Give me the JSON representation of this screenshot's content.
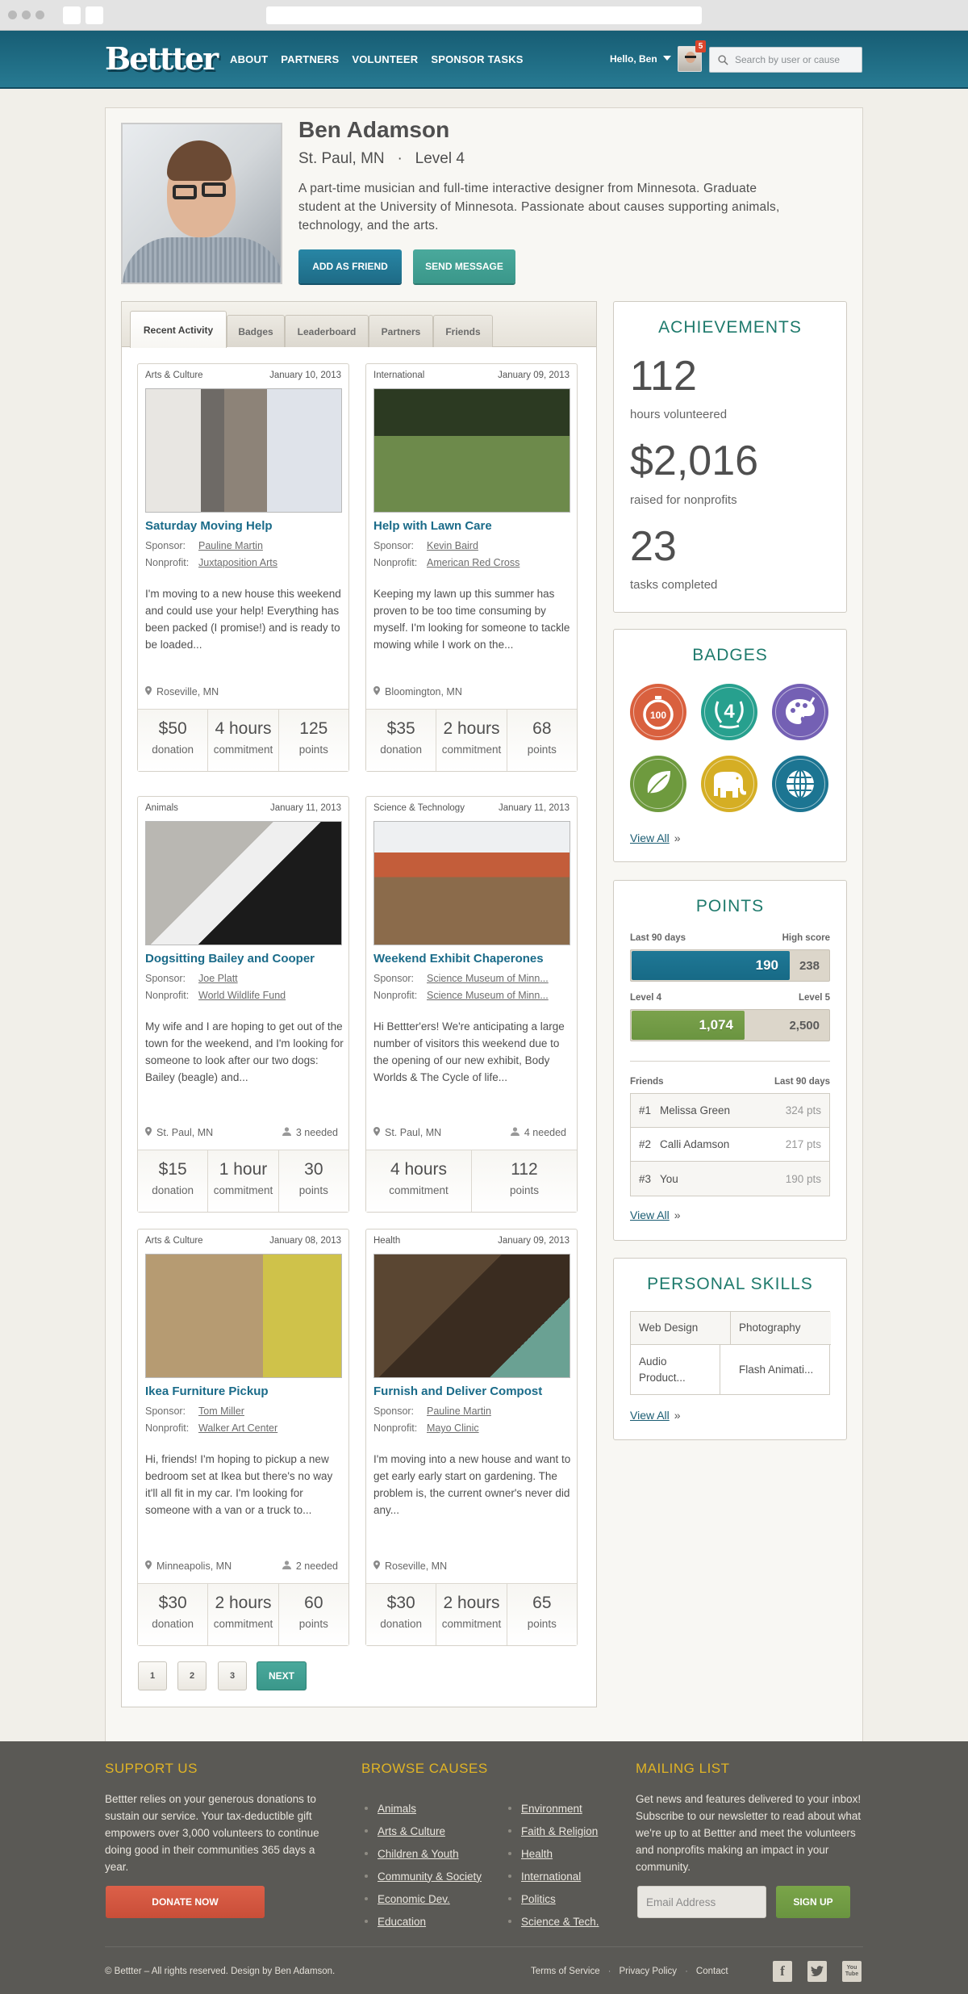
{
  "header": {
    "logo": "Bettter",
    "nav": [
      "ABOUT",
      "PARTNERS",
      "VOLUNTEER",
      "SPONSOR TASKS"
    ],
    "greeting": "Hello, Ben",
    "notification_count": "5",
    "search_placeholder": "Search by user or cause"
  },
  "profile": {
    "name": "Ben Adamson",
    "location_level": "St. Paul, MN   ·   Level 4",
    "bio": "A part-time musician and full-time interactive designer from Minnesota. Graduate student at the University of Minnesota. Passionate about causes supporting animals, technology, and the arts.",
    "add_friend_label": "ADD AS FRIEND",
    "send_message_label": "SEND MESSAGE"
  },
  "tabs": [
    "Recent Activity",
    "Badges",
    "Leaderboard",
    "Partners",
    "Friends"
  ],
  "active_tab": "Recent Activity",
  "cards": [
    {
      "category": "Arts & Culture",
      "date": "January 10, 2013",
      "title": "Saturday Moving Help",
      "sponsor_label": "Sponsor:",
      "sponsor": "Pauline Martin",
      "nonprofit_label": "Nonprofit:",
      "nonprofit": "Juxtaposition Arts",
      "description": "I'm moving to a new house this weekend and could use your help! Everything has been packed (I promise!) and is ready to be loaded...",
      "location": "Roseville, MN",
      "needed": "",
      "stats": [
        {
          "value": "$50",
          "label": "donation"
        },
        {
          "value": "4 hours",
          "label": "commitment"
        },
        {
          "value": "125",
          "label": "points"
        }
      ]
    },
    {
      "category": "International",
      "date": "January 09, 2013",
      "title": "Help with Lawn Care",
      "sponsor_label": "Sponsor:",
      "sponsor": "Kevin Baird",
      "nonprofit_label": "Nonprofit:",
      "nonprofit": "American Red Cross",
      "description": "Keeping my lawn up this summer has proven to be too time consuming by myself. I'm looking for someone to tackle mowing while I work on the...",
      "location": "Bloomington, MN",
      "needed": "",
      "stats": [
        {
          "value": "$35",
          "label": "donation"
        },
        {
          "value": "2 hours",
          "label": "commitment"
        },
        {
          "value": "68",
          "label": "points"
        }
      ]
    },
    {
      "category": "Animals",
      "date": "January 11, 2013",
      "title": "Dogsitting Bailey and Cooper",
      "sponsor_label": "Sponsor:",
      "sponsor": "Joe Platt",
      "nonprofit_label": "Nonprofit:",
      "nonprofit": "World Wildlife Fund",
      "description": "My wife and I are hoping to get out of the town for the weekend, and I'm looking for someone to look after our two dogs: Bailey (beagle) and...",
      "location": "St. Paul, MN",
      "needed": "3 needed",
      "stats": [
        {
          "value": "$15",
          "label": "donation"
        },
        {
          "value": "1 hour",
          "label": "commitment"
        },
        {
          "value": "30",
          "label": "points"
        }
      ]
    },
    {
      "category": "Science & Technology",
      "date": "January 11, 2013",
      "title": "Weekend Exhibit Chaperones",
      "sponsor_label": "Sponsor:",
      "sponsor": "Science Museum of Minn...",
      "nonprofit_label": "Nonprofit:",
      "nonprofit": "Science Museum of Minn...",
      "description": "Hi Bettter'ers! We're anticipating a large number of visitors this weekend due to the opening of our new exhibit, Body Worlds & The Cycle of life...",
      "location": "St. Paul, MN",
      "needed": "4 needed",
      "stats": [
        {
          "value": "4 hours",
          "label": "commitment"
        },
        {
          "value": "112",
          "label": "points"
        }
      ]
    },
    {
      "category": "Arts & Culture",
      "date": "January 08, 2013",
      "title": "Ikea Furniture Pickup",
      "sponsor_label": "Sponsor:",
      "sponsor": "Tom Miller",
      "nonprofit_label": "Nonprofit:",
      "nonprofit": "Walker Art Center",
      "description": "Hi, friends! I'm hoping to pickup a new bedroom set at Ikea but there's no way it'll all fit in my car. I'm looking for someone with a van or a truck to...",
      "location": "Minneapolis, MN",
      "needed": "2 needed",
      "stats": [
        {
          "value": "$30",
          "label": "donation"
        },
        {
          "value": "2 hours",
          "label": "commitment"
        },
        {
          "value": "60",
          "label": "points"
        }
      ]
    },
    {
      "category": "Health",
      "date": "January 09, 2013",
      "title": "Furnish and Deliver Compost",
      "sponsor_label": "Sponsor:",
      "sponsor": "Pauline Martin",
      "nonprofit_label": "Nonprofit:",
      "nonprofit": "Mayo Clinic",
      "description": "I'm moving into a new house and want to get early early start on gardening. The problem is, the current owner's never did any...",
      "location": "Roseville, MN",
      "needed": "",
      "stats": [
        {
          "value": "$30",
          "label": "donation"
        },
        {
          "value": "2 hours",
          "label": "commitment"
        },
        {
          "value": "65",
          "label": "points"
        }
      ]
    }
  ],
  "pagination": {
    "pages": [
      "1",
      "2",
      "3"
    ],
    "next_label": "NEXT"
  },
  "achievements": {
    "title": "ACHIEVEMENTS",
    "items": [
      {
        "value": "112",
        "label": "hours volunteered"
      },
      {
        "value": "$2,016",
        "label": "raised for nonprofits"
      },
      {
        "value": "23",
        "label": "tasks completed"
      }
    ]
  },
  "badges": {
    "title": "BADGES",
    "items": [
      {
        "name": "stopwatch-100",
        "text": "100",
        "color": "#d9603e"
      },
      {
        "name": "laurel-4",
        "text": "4",
        "color": "#27a08e"
      },
      {
        "name": "art-palette",
        "text": "",
        "color": "#7460b4"
      },
      {
        "name": "leaf",
        "text": "",
        "color": "#6e9a3e"
      },
      {
        "name": "elephant",
        "text": "",
        "color": "#d5ae24"
      },
      {
        "name": "globe",
        "text": "",
        "color": "#1c7592"
      }
    ],
    "view_all": "View All",
    "view_all_suffix": "»"
  },
  "points": {
    "title": "POINTS",
    "bar1": {
      "left_label": "Last 90 days",
      "right_label": "High score",
      "value": "190",
      "max": "238",
      "fraction": 0.798,
      "color": "#1f7896"
    },
    "bar2": {
      "left_label": "Level 4",
      "right_label": "Level 5",
      "value": "1,074",
      "max": "2,500",
      "fraction": 0.57,
      "color": "#7ba24c"
    },
    "friends_label": "Friends",
    "friends_period": "Last 90 days",
    "friends": [
      {
        "rank": "#1",
        "name": "Melissa Green",
        "points": "324 pts"
      },
      {
        "rank": "#2",
        "name": "Calli Adamson",
        "points": "217 pts"
      },
      {
        "rank": "#3",
        "name": "You",
        "points": "190 pts"
      }
    ],
    "view_all": "View All",
    "view_all_suffix": "»"
  },
  "skills": {
    "title": "PERSONAL SKILLS",
    "items": [
      "Web Design",
      "Photography",
      "Audio Product...",
      "Flash Animati..."
    ],
    "view_all": "View All",
    "view_all_suffix": "»"
  },
  "footer": {
    "support_title": "SUPPORT US",
    "support_text": "Bettter relies on your generous donations to sustain our service. Your tax-deductible gift empowers over 3,000 volunteers to continue doing good in their communities 365 days a year.",
    "donate_label": "DONATE NOW",
    "causes_title": "BROWSE CAUSES",
    "causes_col1": [
      "Animals",
      "Arts & Culture",
      "Children & Youth",
      "Community & Society",
      "Economic Dev.",
      "Education"
    ],
    "causes_col2": [
      "Environment",
      "Faith & Religion",
      "Health",
      "International",
      "Politics",
      "Science & Tech."
    ],
    "mailing_title": "MAILING LIST",
    "mailing_text": "Get news and features delivered to your inbox! Subscribe to our newsletter to read about what we're up to at Bettter and meet the volunteers and nonprofits making an impact in your community.",
    "email_placeholder": "Email Address",
    "signup_label": "SIGN UP",
    "copyright": "© Bettter – All rights reserved.  Design by Ben Adamson.",
    "links": [
      "Terms of Service",
      "Privacy Policy",
      "Contact"
    ],
    "social": [
      "facebook",
      "twitter",
      "youtube"
    ]
  }
}
